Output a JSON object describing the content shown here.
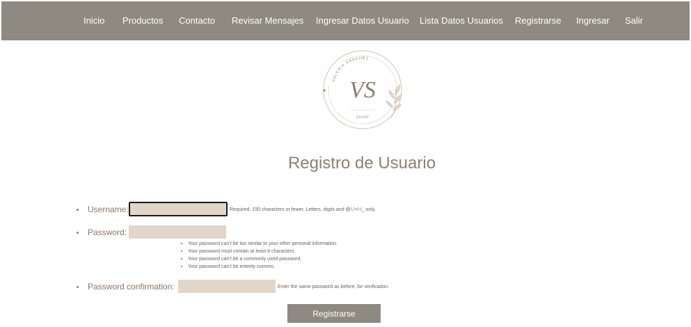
{
  "nav": {
    "items": [
      {
        "label": "Inicio"
      },
      {
        "label": "Productos"
      },
      {
        "label": "Contacto"
      },
      {
        "label": "Revisar Mensajes"
      },
      {
        "label": "Ingresar Datos Usuario"
      },
      {
        "label": "Lista Datos Usuarios"
      },
      {
        "label": "Registrarse"
      },
      {
        "label": "Ingresar"
      },
      {
        "label": "Salir"
      }
    ]
  },
  "logo": {
    "arc_text": "VALERIA SANCHEZ",
    "monogram": "VS",
    "sub_text": "SHOP"
  },
  "page": {
    "title": "Registro de Usuario"
  },
  "form": {
    "username": {
      "label": "Username:",
      "value": "",
      "help": "Required. 150 characters or fewer. Letters, digits and @/./+/-/_ only."
    },
    "password": {
      "label": "Password:",
      "value": "",
      "help": [
        "Your password can’t be too similar to your other personal information.",
        "Your password must contain at least 8 characters.",
        "Your password can’t be a commonly used password.",
        "Your password can’t be entirely numeric."
      ]
    },
    "password_confirmation": {
      "label": "Password confirmation:",
      "value": "",
      "help": "Enter the same password as before, for verification."
    },
    "submit_label": "Registrarse"
  },
  "colors": {
    "navbar_bg": "#8e8a82",
    "input_bg": "#e2d6c8",
    "title_color": "#8d8070",
    "label_color": "#8a7466"
  }
}
